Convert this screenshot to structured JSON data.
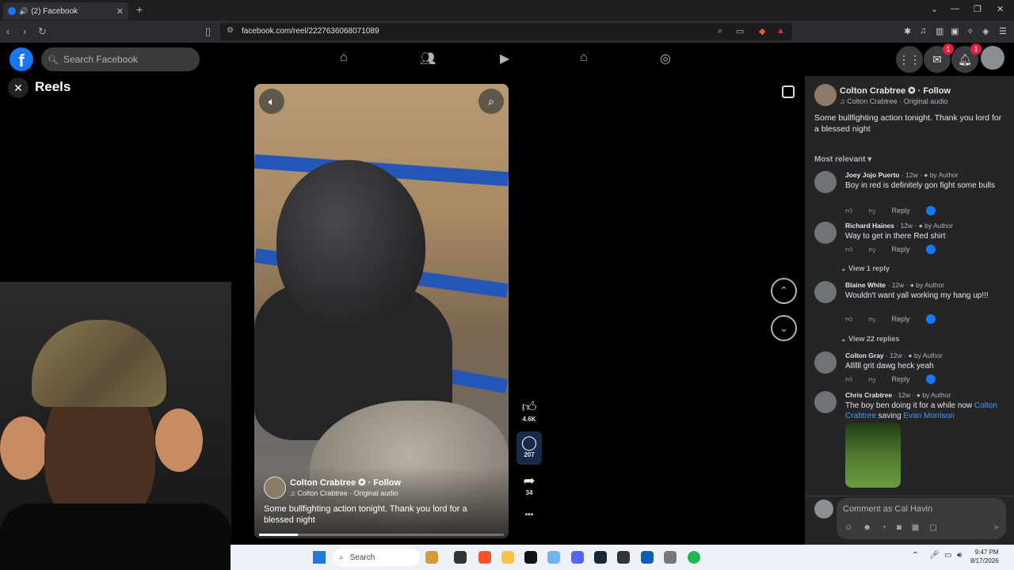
{
  "browser": {
    "tab_title": "(2) Facebook",
    "tab_audio_icon": "speaker-icon",
    "new_tab_label": "+",
    "url": "facebook.com/reel/2227636068071089"
  },
  "fb": {
    "search_placeholder": "Search Facebook",
    "messenger_badge": "1",
    "notifications_badge": "1",
    "brand_color": "#1877f2"
  },
  "reels": {
    "title": "Reels"
  },
  "video": {
    "author": "Colton Crabtree",
    "follow_label": "Follow",
    "audio": "Colton Crabtree · Original audio",
    "caption": "Some bullfighting action tonight. Thank you lord for a blessed night",
    "progress_fraction": 0.16,
    "likes": "4.6K",
    "comments": "207",
    "shares": "34",
    "more_label": "•••"
  },
  "panel": {
    "author": "Colton Crabtree",
    "follow_label": "Follow",
    "audio": "Colton Crabtree · Original audio",
    "caption": "Some bullfighting action tonight. Thank you lord for a blessed night",
    "sort_label": "Most relevant",
    "comments": [
      {
        "name": "Joey Jojo Puerto",
        "meta": " · 12w · ",
        "by": "by Author",
        "text": "Boy in red is definitely gon fight some bulls",
        "reply": "Reply"
      },
      {
        "name": "Richard Haines",
        "meta": " · 12w · ",
        "by": "by Author",
        "text": "Way to get in there Red shirt",
        "reply": "Reply"
      },
      {
        "name": "Blaine White",
        "meta": " · 12w · ",
        "by": "by Author",
        "text": "Wouldn't want yall working my hang up!!!",
        "reply": "Reply"
      },
      {
        "name": "Colton Gray",
        "meta": " · 12w · ",
        "by": "by Author",
        "text": "Allllll grit dawg heck yeah",
        "reply": "Reply"
      },
      {
        "name": "Chris Crabtree",
        "meta": " · 12w · ",
        "by": "by Author",
        "text_prefix": "The boy ben doing it for a while now ",
        "mention1": "Colton Crabtree",
        "text_mid": " saving ",
        "mention2": "Evan Morrison"
      }
    ],
    "view_replies_1": "View 1 reply",
    "view_replies_2": "View 22 replies",
    "comment_placeholder": "Comment as Cal Havin"
  },
  "taskbar": {
    "search_label": "Search",
    "time": "9:47 PM",
    "date": "8/17/2026"
  }
}
